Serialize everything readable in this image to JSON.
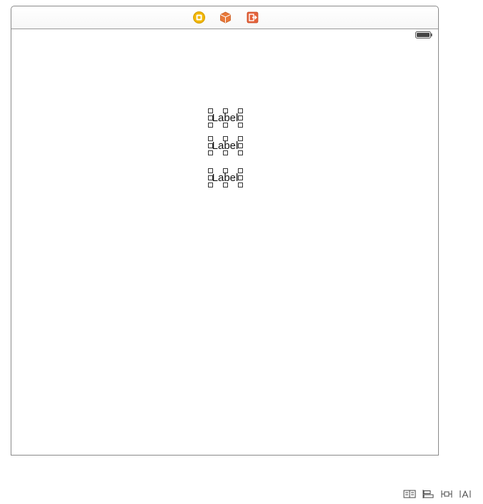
{
  "scene_dock": {
    "icons": [
      "view-controller-icon",
      "first-responder-icon",
      "exit-icon"
    ],
    "colors": {
      "view_controller": "#f2b705",
      "first_responder": "#e8793a",
      "exit": "#e5623a"
    }
  },
  "status_bar": {
    "battery": "battery-icon"
  },
  "labels": [
    {
      "text": "Label"
    },
    {
      "text": "Label"
    },
    {
      "text": "Label"
    }
  ],
  "bottom_toolbar": {
    "icons": [
      "stack-icon",
      "align-icon",
      "pin-icon",
      "resolve-issues-icon"
    ]
  }
}
